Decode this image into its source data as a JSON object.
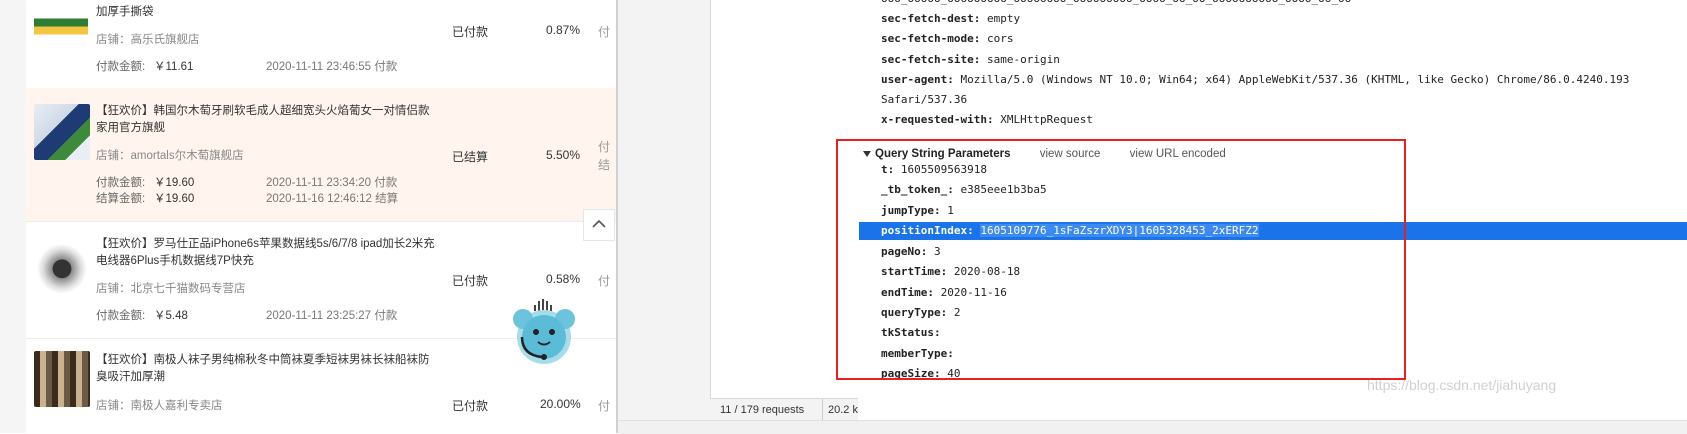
{
  "orders": [
    {
      "title": "加厚手撕袋",
      "shop": "店铺：高乐氏旗舰店",
      "status": "已付款",
      "rate": "0.87%",
      "cut": "付",
      "pay_label": "付款金额:",
      "pay_amount": "￥11.61",
      "pay_time": "2020-11-11 23:46:55 付款"
    },
    {
      "title": "【狂欢价】韩国尔木萄牙刷软毛成人超细宽头火焰葡女一对情侣款家用官方旗舰",
      "shop": "店铺：amortals尔木萄旗舰店",
      "status": "已结算",
      "rate": "5.50%",
      "cut": "付",
      "cut2": "结",
      "pay_label": "付款金额:",
      "pay_amount": "￥19.60",
      "pay_time": "2020-11-11 23:34:20 付款",
      "settle_label": "结算金额:",
      "settle_amount": "￥19.60",
      "settle_time": "2020-11-16 12:46:12 结算"
    },
    {
      "title": "【狂欢价】罗马仕正品iPhone6s苹果数据线5s/6/7/8 ipad加长2米充电线器6Plus手机数据线7P快充",
      "shop": "店铺：北京七千猫数码专营店",
      "status": "已付款",
      "rate": "0.58%",
      "cut": "付",
      "pay_label": "付款金额:",
      "pay_amount": "￥5.48",
      "pay_time": "2020-11-11 23:25:27 付款"
    },
    {
      "title": "【狂欢价】南极人袜子男纯棉秋冬中筒袜夏季短袜男袜长袜船袜防臭吸汗加厚潮",
      "shop": "店铺：南极人嘉利专卖店",
      "status": "已付款",
      "rate": "20.00%",
      "cut": "付"
    }
  ],
  "devtools": {
    "status_requests": "11 / 179 requests",
    "status_size": "20.2 k",
    "headers": [
      {
        "k": "sec-fetch-dest:",
        "v": "empty"
      },
      {
        "k": "sec-fetch-mode:",
        "v": "cors"
      },
      {
        "k": "sec-fetch-site:",
        "v": "same-origin"
      },
      {
        "k": "user-agent:",
        "v": "Mozilla/5.0 (Windows NT 10.0; Win64; x64) AppleWebKit/537.36 (KHTML, like Gecko) Chrome/86.0.4240.193"
      },
      {
        "k": "",
        "v": "Safari/537.36"
      },
      {
        "k": "x-requested-with:",
        "v": "XMLHttpRequest"
      }
    ],
    "query_title": "Query String Parameters",
    "view_source": "view source",
    "view_url_encoded": "view URL encoded",
    "params": [
      {
        "k": "t:",
        "v": "1605509563918"
      },
      {
        "k": "_tb_token_:",
        "v": "e385eee1b3ba5"
      },
      {
        "k": "jumpType:",
        "v": "1"
      },
      {
        "k": "positionIndex:",
        "v": "1605109776_1sFaZszrXDY3|1605328453_2xERFZ2"
      },
      {
        "k": "pageNo:",
        "v": "3"
      },
      {
        "k": "startTime:",
        "v": "2020-08-18"
      },
      {
        "k": "endTime:",
        "v": "2020-11-16"
      },
      {
        "k": "queryType:",
        "v": "2"
      },
      {
        "k": "tkStatus:",
        "v": ""
      },
      {
        "k": "memberType:",
        "v": ""
      },
      {
        "k": "pageSize:",
        "v": "40"
      }
    ]
  },
  "watermark": "https://blog.csdn.net/jiahuyang",
  "colors": {
    "selection": "#1a73e8",
    "annotation_box": "#e8201f",
    "highlight_row": "#fff5ee"
  }
}
